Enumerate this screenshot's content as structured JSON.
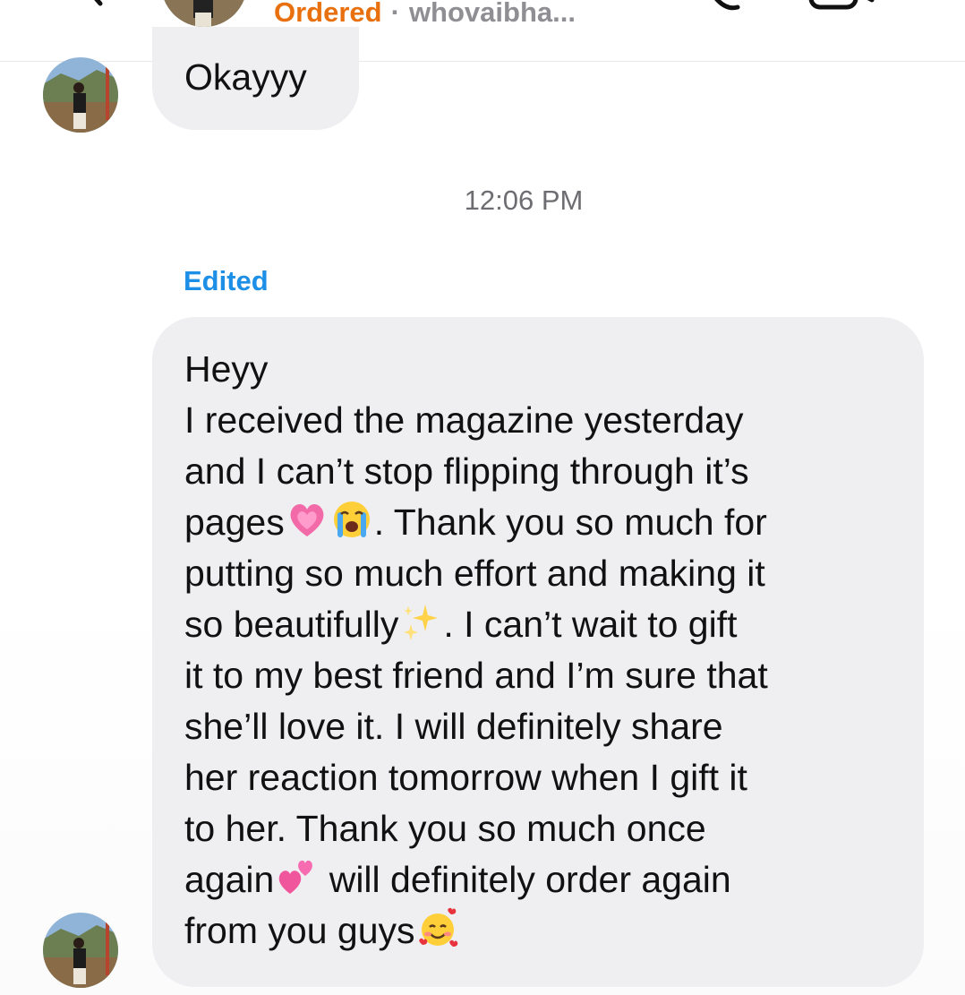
{
  "header": {
    "order_status": "Ordered",
    "separator": "·",
    "username": "whovaibha...",
    "icons": [
      "back-chevron-icon",
      "phone-icon",
      "video-camera-icon"
    ],
    "status_color": "#e8700e"
  },
  "messages": [
    {
      "lines": [
        "Okayyy"
      ]
    }
  ],
  "timestamp": "12:06 PM",
  "edited_label": "Edited",
  "main_message": {
    "lines": [
      {
        "parts": [
          "Heyy"
        ]
      },
      {
        "parts": [
          "I received the magazine yesterday"
        ]
      },
      {
        "parts": [
          "and I can’t stop flipping through it’s"
        ]
      },
      {
        "parts": [
          "pages",
          ". Thank you so much for"
        ],
        "emojis": [
          "growing-heart-emoji",
          "loudly-crying-face-emoji"
        ]
      },
      {
        "parts": [
          "putting so much effort and making it"
        ]
      },
      {
        "parts": [
          "so beautifully",
          ". I can’t wait to gift"
        ],
        "emojis": [
          "sparkles-emoji"
        ]
      },
      {
        "parts": [
          "it to my best friend and I’m sure that"
        ]
      },
      {
        "parts": [
          "she’ll love it. I will definitely share"
        ]
      },
      {
        "parts": [
          "her reaction tomorrow when I gift it"
        ]
      },
      {
        "parts": [
          "to her. Thank you so much once"
        ]
      },
      {
        "parts": [
          "again",
          " will definitely order again"
        ],
        "emojis": [
          "two-hearts-emoji"
        ]
      },
      {
        "parts": [
          "from you guys"
        ],
        "emojis": [
          "smiling-face-with-hearts-emoji"
        ]
      }
    ]
  },
  "colors": {
    "bubble": "#efeff2",
    "edited": "#1d8fe6",
    "timestamp": "#6d6d72"
  }
}
